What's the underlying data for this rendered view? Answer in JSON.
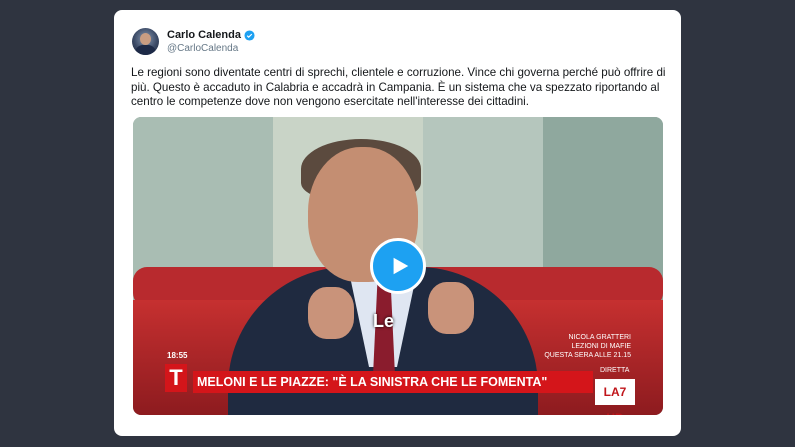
{
  "tweet": {
    "author_name": "Carlo Calenda",
    "author_handle": "@CarloCalenda",
    "verified": true,
    "text": "Le regioni sono diventate centri di sprechi, clientele e corruzione. Vince chi governa perché può offrire di più. Questo è accaduto in Calabria e accadrà in Campania. È un sistema che va spezzato riportando al centro le competenze dove non vengono esercitate nell'interesse dei cittadini."
  },
  "video": {
    "caption": "Le",
    "clock": "18:55",
    "promo_line1": "NICOLA GRATTERI",
    "promo_line2": "LEZIONI DI MAFIE",
    "promo_line3": "QUESTA SERA ALLE 21.15",
    "banner_logo": "T",
    "banner_text": "MELONI E LE PIAZZE: \"È LA SINISTRA CHE LE FOMENTA\"",
    "channel_status": "DIRETTA",
    "channel_logo": "LA7 HD"
  },
  "colors": {
    "background": "#2f3440",
    "card": "#ffffff",
    "play_button": "#1da1f2",
    "banner_red": "#d4151a"
  }
}
